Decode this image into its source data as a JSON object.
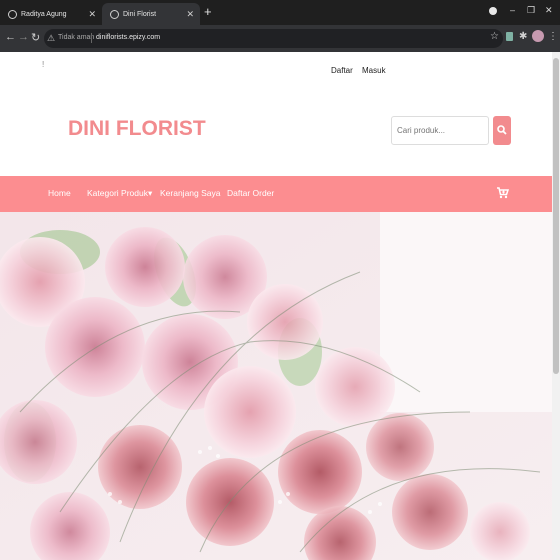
{
  "browser": {
    "tabs": [
      {
        "title": "Raditya Agung"
      },
      {
        "title": "Dini Florist"
      }
    ],
    "address": {
      "security_label": "Tidak aman",
      "url": "diniflorists.epizy.com"
    }
  },
  "header": {
    "top_note": "!",
    "links": [
      {
        "label": "Daftar"
      },
      {
        "label": "Masuk"
      }
    ],
    "brand": "DINI FLORIST",
    "search": {
      "placeholder": "Cari produk..."
    }
  },
  "nav": {
    "items": [
      {
        "label": "Home"
      },
      {
        "label": "Kategori Produk▾"
      },
      {
        "label": "Keranjang Saya"
      },
      {
        "label": "Daftar Order"
      }
    ]
  },
  "colors": {
    "brand": "#f28b8e",
    "navbar": "#fc8d90"
  }
}
